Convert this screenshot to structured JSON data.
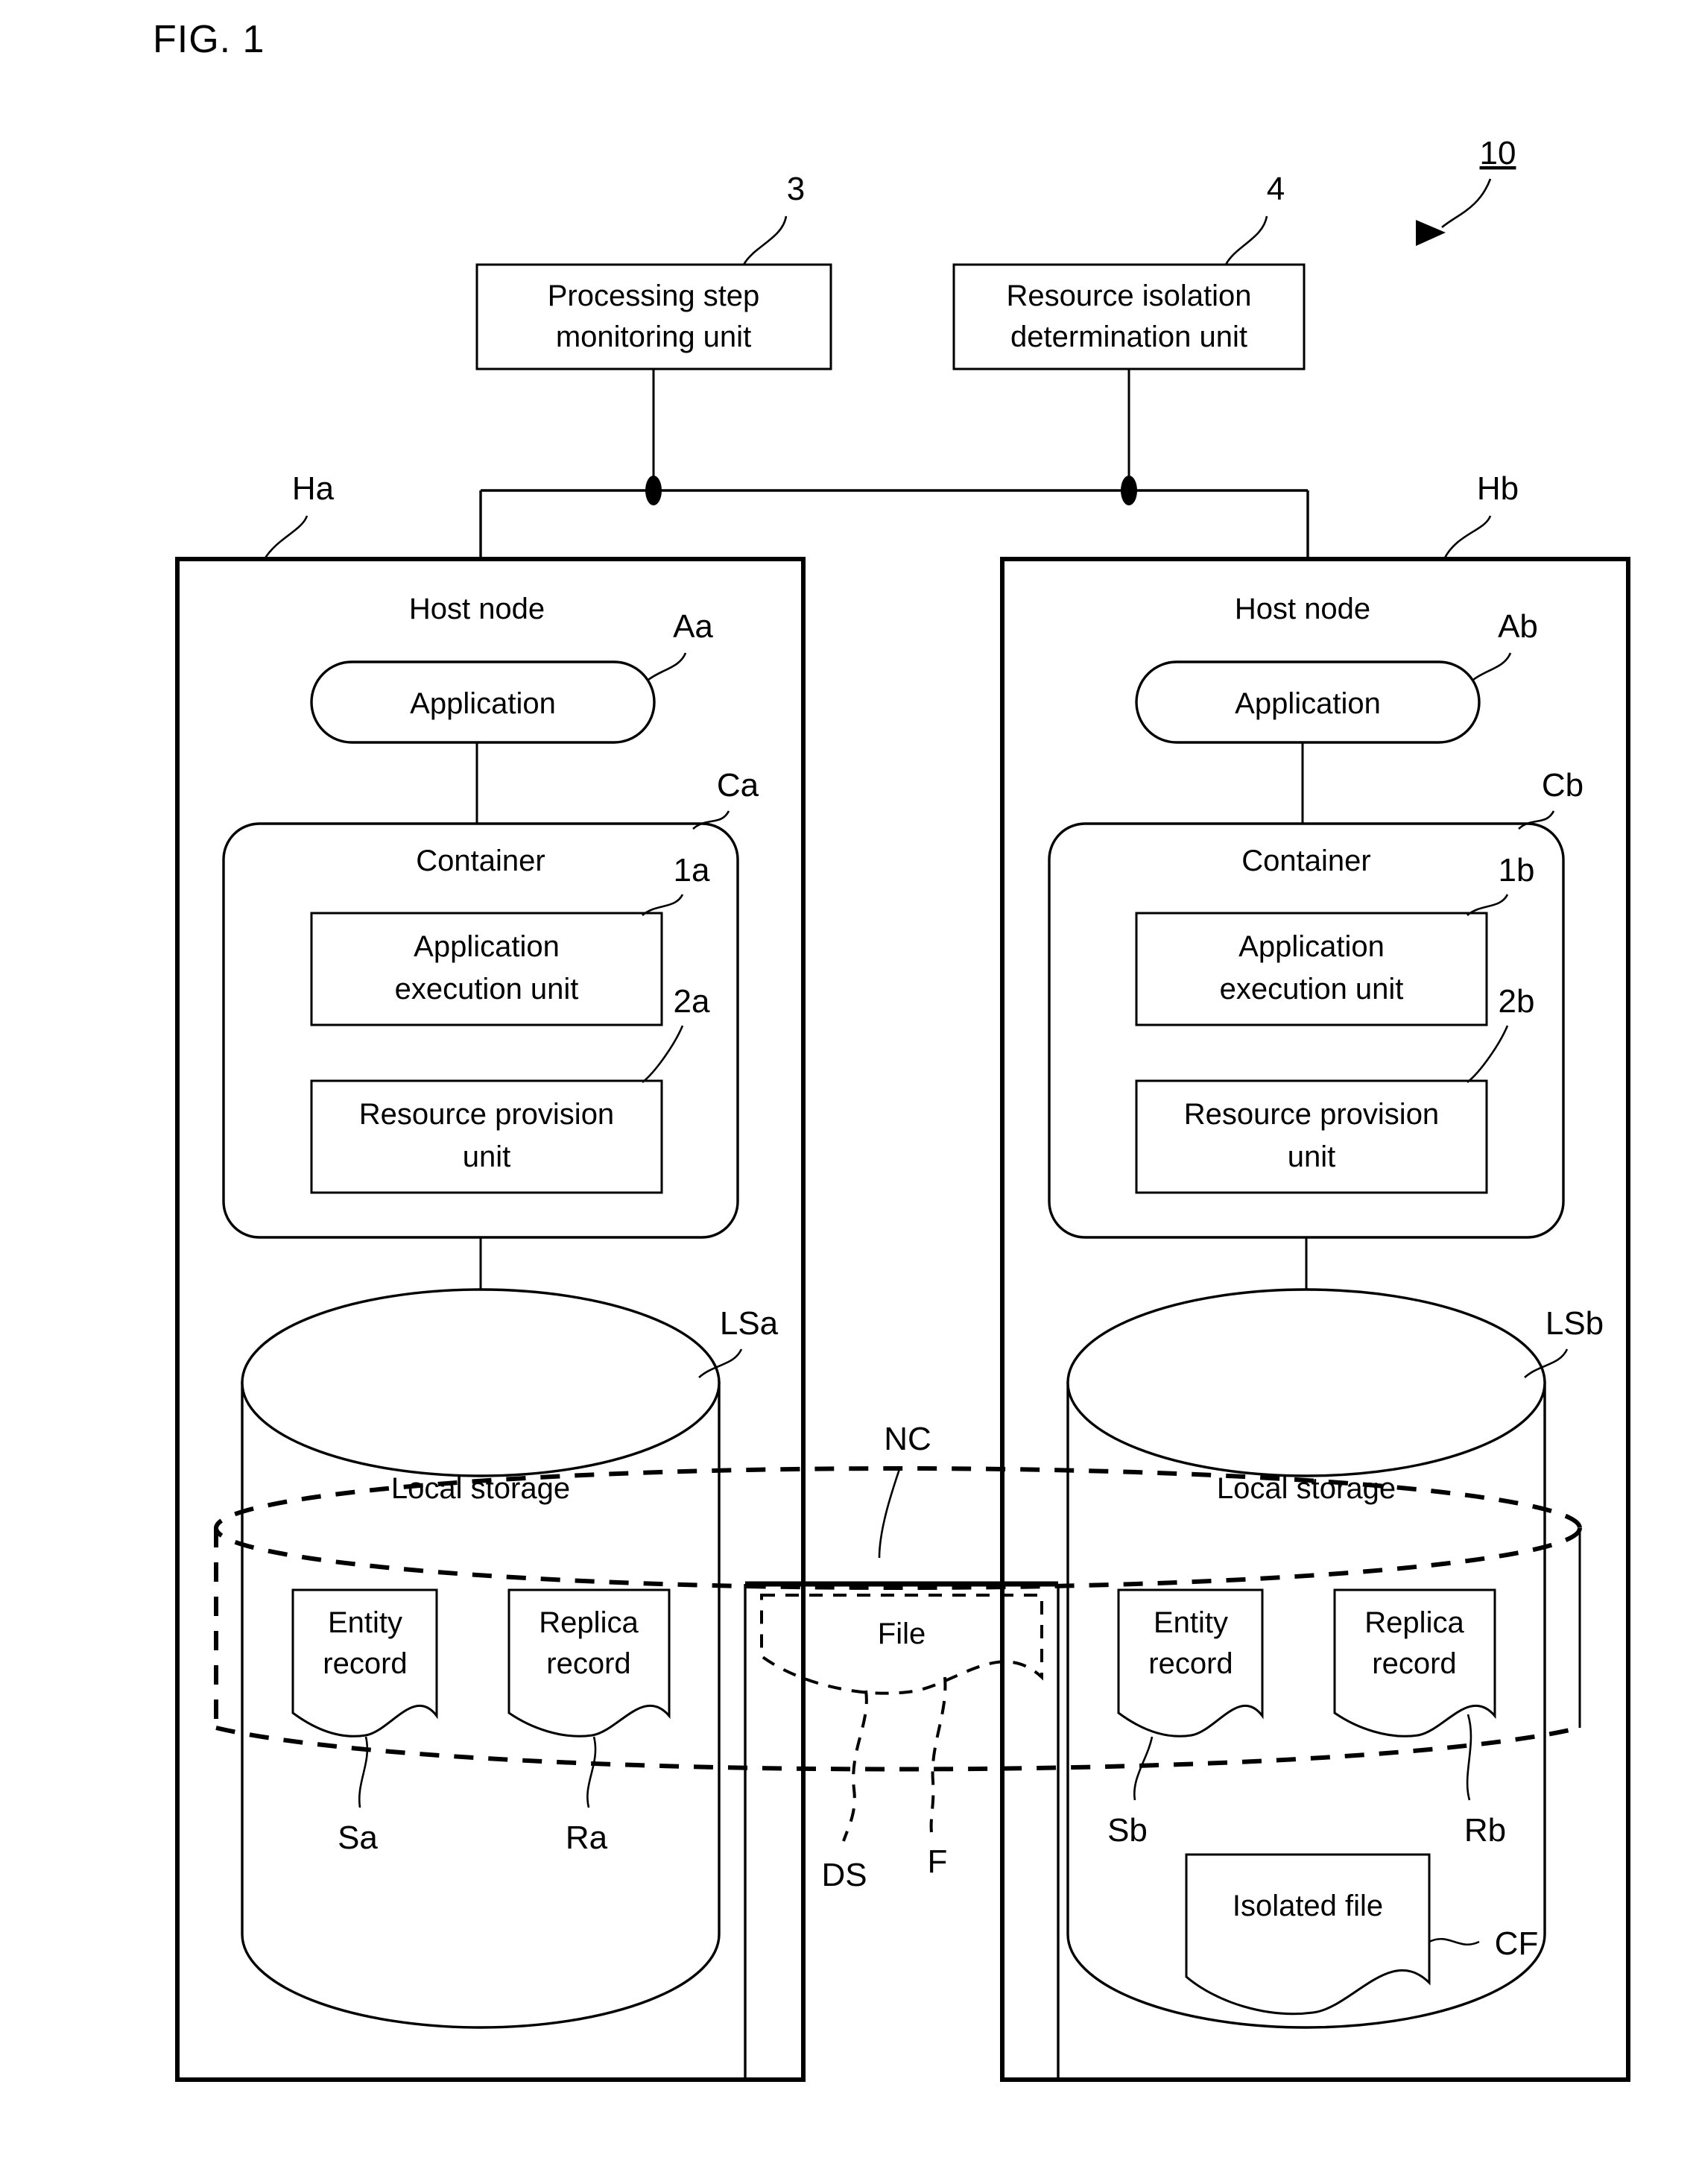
{
  "figure": {
    "title": "FIG. 1",
    "system_ref": "10"
  },
  "top_units": [
    {
      "label": "Processing step\nmonitoring unit",
      "line1": "Processing step",
      "line2": "monitoring unit",
      "ref": "3"
    },
    {
      "label": "Resource isolation\ndetermination unit",
      "line1": "Resource isolation",
      "line2": "determination unit",
      "ref": "4"
    }
  ],
  "nodes": [
    {
      "ref": "Ha",
      "title": "Host node",
      "application": {
        "label": "Application",
        "ref": "Aa"
      },
      "container": {
        "label": "Container",
        "ref": "Ca",
        "units": [
          {
            "line1": "Application",
            "line2": "execution unit",
            "ref": "1a"
          },
          {
            "line1": "Resource provision",
            "line2": "unit",
            "ref": "2a"
          }
        ]
      },
      "storage": {
        "label": "Local storage",
        "ref": "LSa",
        "records": [
          {
            "line1": "Entity",
            "line2": "record",
            "ref": "Sa"
          },
          {
            "line1": "Replica",
            "line2": "record",
            "ref": "Ra"
          }
        ],
        "isolated_file": null
      }
    },
    {
      "ref": "Hb",
      "title": "Host node",
      "application": {
        "label": "Application",
        "ref": "Ab"
      },
      "container": {
        "label": "Container",
        "ref": "Cb",
        "units": [
          {
            "line1": "Application",
            "line2": "execution unit",
            "ref": "1b"
          },
          {
            "line1": "Resource provision",
            "line2": "unit",
            "ref": "2b"
          }
        ]
      },
      "storage": {
        "label": "Local storage",
        "ref": "LSb",
        "records": [
          {
            "line1": "Entity",
            "line2": "record",
            "ref": "Sb"
          },
          {
            "line1": "Replica",
            "line2": "record",
            "ref": "Rb"
          }
        ],
        "isolated_file": {
          "label": "Isolated file",
          "ref": "CF"
        }
      }
    }
  ],
  "shared": {
    "cluster_ref": "NC",
    "file": {
      "label": "File",
      "ref_ds": "DS",
      "ref_f": "F"
    }
  },
  "colors": {
    "line": "#000000",
    "background": "#ffffff"
  }
}
